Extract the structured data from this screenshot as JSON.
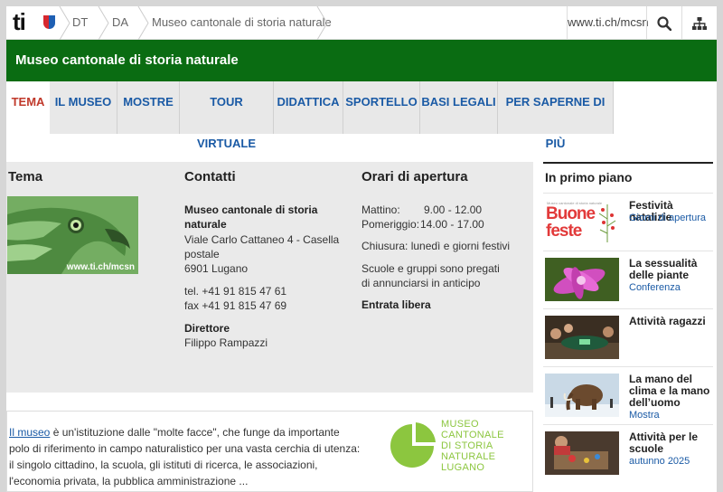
{
  "header": {
    "logo_text": "ti",
    "breadcrumbs": [
      "DT",
      "DA",
      "Museo cantonale di storia naturale"
    ],
    "site_link": "www.ti.ch/mcsn",
    "icons": [
      "search-icon",
      "sitemap-icon"
    ]
  },
  "title_bar": {
    "title": "Museo cantonale di storia naturale"
  },
  "nav": {
    "tabs": [
      {
        "label": "TEMA",
        "active": true
      },
      {
        "label": "IL MUSEO"
      },
      {
        "label": "MOSTRE"
      },
      {
        "label": "TOUR VIRTUALE"
      },
      {
        "label": "DIDATTICA"
      },
      {
        "label": "SPORTELLO"
      },
      {
        "label": "BASI LEGALI"
      },
      {
        "label": "PER SAPERNE DI PIÙ"
      }
    ]
  },
  "tema": {
    "title": "Tema",
    "image_caption": "www.ti.ch/mcsn"
  },
  "contatti": {
    "title": "Contatti",
    "name_line1": "Museo cantonale di storia",
    "name_line2": "naturale",
    "address_line1": "Viale Carlo Cattaneo 4 - Casella",
    "address_line2": "postale",
    "address_line3": "6901 Lugano",
    "tel": "tel. +41 91 815 47 61",
    "fax": "fax +41 91 815 47 69",
    "director_label": "Direttore",
    "director_name": "Filippo Rampazzi"
  },
  "orari": {
    "title": "Orari di apertura",
    "morning_label": "Mattino:",
    "morning_hours": "9.00 - 12.00",
    "afternoon_label": "Pomeriggio:",
    "afternoon_hours": "14.00 - 17.00",
    "closed": "Chiusura: lunedì e giorni festivi",
    "groups_line1": "Scuole e gruppi sono pregati",
    "groups_line2": "di annunciarsi in anticipo",
    "entry": "Entrata libera"
  },
  "info": {
    "link_text": "Il museo",
    "text": " è un'istituzione dalle \"molte facce\", che funge da importante polo di riferimento in campo naturalistico per una vasta cerchia di utenza: il singolo cittadino, la scuola, gli istituti di ricerca, le associazioni, l'economia privata, la pubblica amministrazione ...",
    "logo_lines": [
      "MUSEO",
      "CANTONALE",
      "DI STORIA",
      "NATURALE",
      "LUGANO"
    ]
  },
  "sidebar": {
    "title": "In primo piano",
    "items": [
      {
        "heading": "Festività natalizie",
        "sub": "Giorni di apertura",
        "thumb_text_1": "Buone",
        "thumb_text_2": "feste",
        "thumb_small": "Museo cantonale di storia naturale"
      },
      {
        "heading": "La sessualità delle piante",
        "sub": "Conferenza"
      },
      {
        "heading": "Attività ragazzi",
        "sub": ""
      },
      {
        "heading": "La mano del clima e la mano dell’uomo",
        "sub": "Mostra"
      },
      {
        "heading": "Attività per le scuole",
        "sub": "autunno 2025"
      }
    ]
  }
}
